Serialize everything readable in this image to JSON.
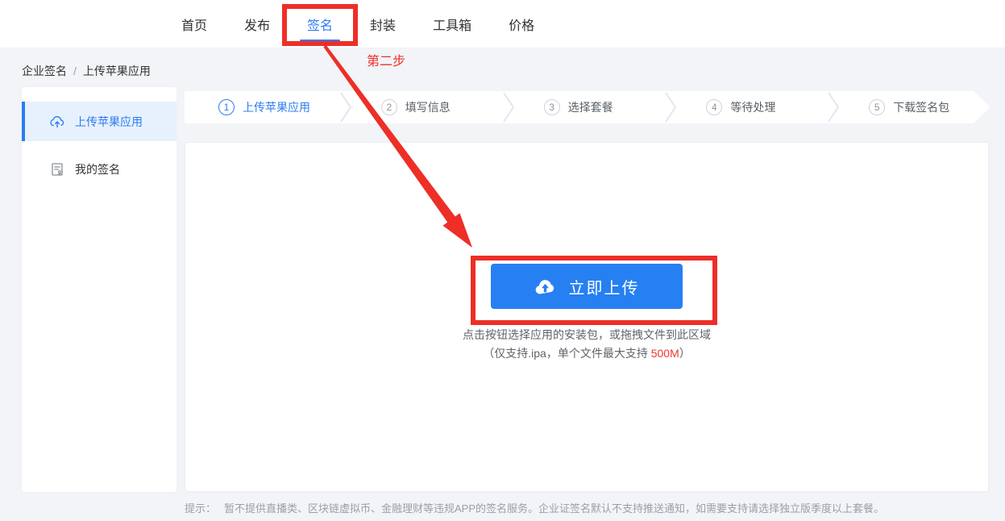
{
  "header": {
    "nav_items": [
      {
        "label": "首页",
        "active": false
      },
      {
        "label": "发布",
        "active": false
      },
      {
        "label": "签名",
        "active": true
      },
      {
        "label": "封装",
        "active": false
      },
      {
        "label": "工具箱",
        "active": false
      },
      {
        "label": "价格",
        "active": false
      }
    ]
  },
  "annotation": {
    "step_text": "第二步",
    "color": "#ed2f27"
  },
  "breadcrumb": {
    "item1": "企业签名",
    "separator": "/",
    "item2": "上传苹果应用"
  },
  "sidebar": {
    "items": [
      {
        "label": "上传苹果应用",
        "icon": "cloud-upload-icon",
        "active": true
      },
      {
        "label": "我的签名",
        "icon": "my-signature-icon",
        "active": false
      }
    ]
  },
  "steps": {
    "items": [
      {
        "num": "1",
        "label": "上传苹果应用",
        "active": true
      },
      {
        "num": "2",
        "label": "填写信息",
        "active": false
      },
      {
        "num": "3",
        "label": "选择套餐",
        "active": false
      },
      {
        "num": "4",
        "label": "等待处理",
        "active": false
      },
      {
        "num": "5",
        "label": "下载签名包",
        "active": false
      }
    ]
  },
  "upload": {
    "button_label": "立即上传",
    "button_icon": "cloud-upload-icon",
    "hint_line1": "点击按钮选择应用的安装包，或拖拽文件到此区域",
    "hint_line2_prefix": "（仅支持.ipa，单个文件最大支持 ",
    "hint_highlight": "500M",
    "hint_line2_suffix": "）"
  },
  "footer": {
    "prefix": "提示：",
    "text": "暂不提供直播类、区块链虚拟币、金融理财等违规APP的签名服务。企业证签名默认不支持推送通知，如需要支持请选择独立版季度以上套餐。"
  },
  "colors": {
    "accent": "#2b7cf2",
    "button_blue": "#2680f2",
    "annotation_red": "#ed2f27",
    "highlight_red": "#f5352e",
    "active_item_bg": "#e7f1fd"
  }
}
